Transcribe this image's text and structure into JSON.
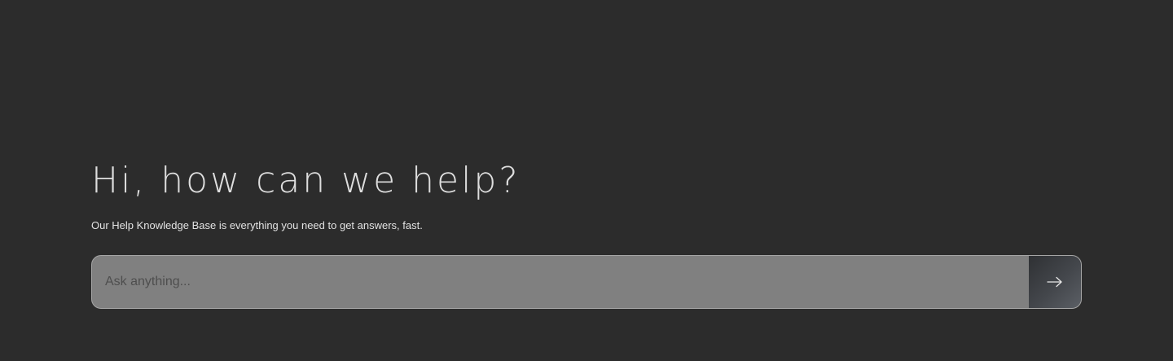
{
  "hero": {
    "title": "Hi, how can we help?",
    "subtitle": "Our Help Knowledge Base is everything you need to get answers, fast."
  },
  "search": {
    "placeholder": "Ask anything...",
    "value": "",
    "submit_icon": "arrow-right-icon"
  },
  "colors": {
    "background": "#2c2c2c",
    "search_field": "#808080",
    "submit_button": "#44474c"
  }
}
